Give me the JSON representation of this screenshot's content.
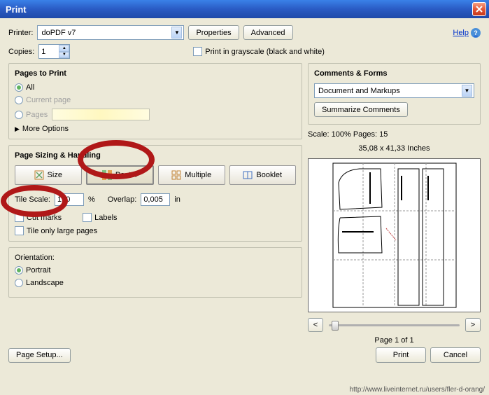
{
  "title": "Print",
  "printer": {
    "label": "Printer:",
    "value": "doPDF v7",
    "properties": "Properties",
    "advanced": "Advanced"
  },
  "help": "Help",
  "copies": {
    "label": "Copies:",
    "value": "1"
  },
  "grayscale": "Print in grayscale (black and white)",
  "pages_to_print": {
    "title": "Pages to Print",
    "all": "All",
    "current": "Current page",
    "pages": "Pages",
    "pages_value": "",
    "more": "More Options"
  },
  "sizing": {
    "title": "Page Sizing & Handling",
    "size": "Size",
    "poster": "Poster",
    "multiple": "Multiple",
    "booklet": "Booklet",
    "tile_scale": "Tile Scale:",
    "tile_value": "100",
    "pct": "%",
    "overlap": "Overlap:",
    "overlap_value": "0,005",
    "unit": "in",
    "cut_marks": "Cut marks",
    "labels": "Labels",
    "tile_large": "Tile only large pages"
  },
  "orientation": {
    "title": "Orientation:",
    "portrait": "Portrait",
    "landscape": "Landscape"
  },
  "comments": {
    "title": "Comments & Forms",
    "value": "Document and Markups",
    "summarize": "Summarize Comments"
  },
  "preview": {
    "scale": "Scale: 100% Pages: 15",
    "dims": "35,08 x 41,33 Inches",
    "page_info": "Page 1 of 1"
  },
  "buttons": {
    "page_setup": "Page Setup...",
    "print": "Print",
    "cancel": "Cancel"
  },
  "nav": {
    "prev": "<",
    "next": ">"
  },
  "footer_url": "http://www.liveinternet.ru/users/fler-d-orang/"
}
